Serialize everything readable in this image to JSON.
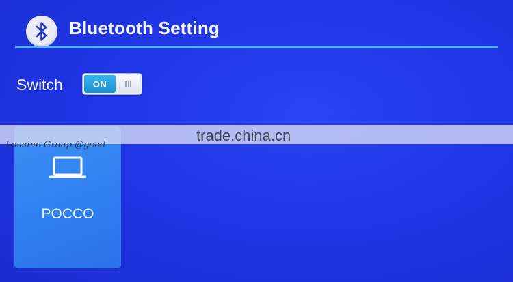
{
  "header": {
    "title": "Bluetooth Setting",
    "icon": "bluetooth-icon"
  },
  "switch": {
    "label": "Switch",
    "state_label": "ON",
    "enabled": true
  },
  "devices": [
    {
      "name": "POCCO",
      "icon": "laptop-icon"
    }
  ],
  "watermark": {
    "site": "trade.china.cn",
    "company": "Losnine Group @good"
  },
  "colors": {
    "background": "#2036e6",
    "divider": "#34c6f2",
    "toggle_on": "#1d8fd3",
    "card": "#2f7ff0"
  }
}
